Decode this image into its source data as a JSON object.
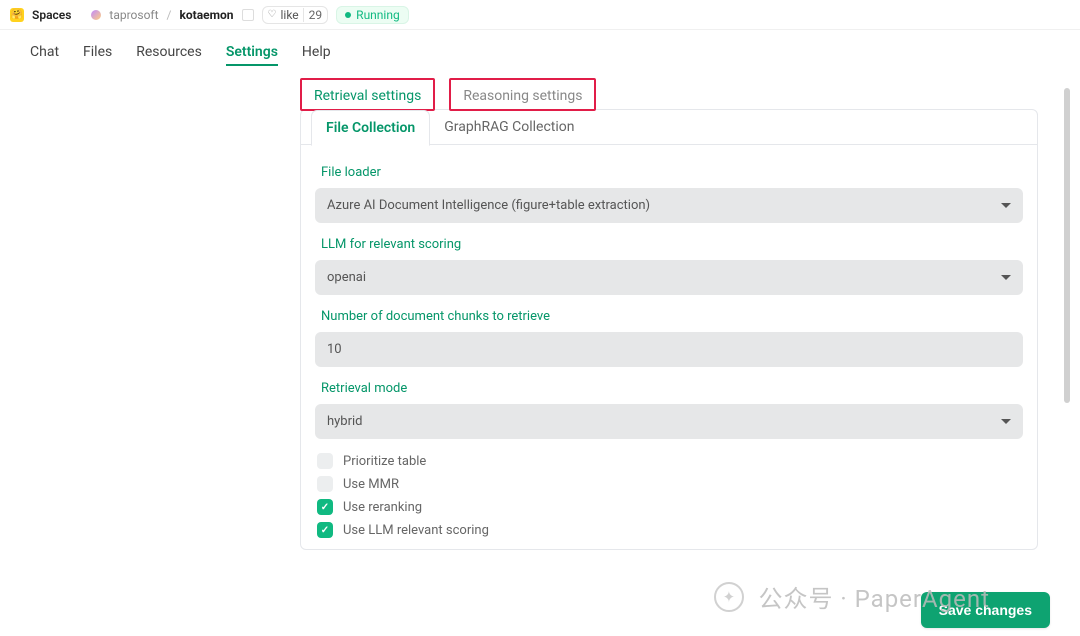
{
  "topbar": {
    "spaces_label": "Spaces",
    "org": "taprosoft",
    "project": "kotaemon",
    "like_label": "like",
    "like_count": "29",
    "status": "Running"
  },
  "nav": {
    "items": [
      "Chat",
      "Files",
      "Resources",
      "Settings",
      "Help"
    ],
    "active_index": 3
  },
  "tabs_primary": {
    "items": [
      "Retrieval settings",
      "Reasoning settings"
    ],
    "active_index": 0
  },
  "tabs_secondary": {
    "items": [
      "File Collection",
      "GraphRAG Collection"
    ],
    "active_index": 0
  },
  "form": {
    "file_loader": {
      "label": "File loader",
      "value": "Azure AI Document Intelligence (figure+table extraction)"
    },
    "llm_scoring": {
      "label": "LLM for relevant scoring",
      "value": "openai"
    },
    "chunks": {
      "label": "Number of document chunks to retrieve",
      "value": "10"
    },
    "retrieval_mode": {
      "label": "Retrieval mode",
      "value": "hybrid"
    },
    "checks": [
      {
        "label": "Prioritize table",
        "checked": false
      },
      {
        "label": "Use MMR",
        "checked": false
      },
      {
        "label": "Use reranking",
        "checked": true
      },
      {
        "label": "Use LLM relevant scoring",
        "checked": true
      }
    ]
  },
  "actions": {
    "save": "Save changes"
  },
  "watermark": {
    "text": "公众号 · PaperAgent"
  }
}
